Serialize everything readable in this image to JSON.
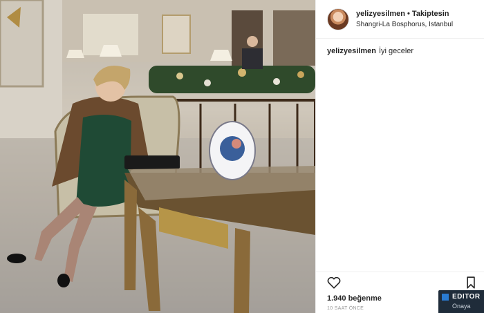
{
  "post": {
    "image_description_alt": "",
    "author": {
      "username": "yelizyesilmen",
      "separator": "•",
      "follow_status": "Takiptesin",
      "location": "Shangri-La Bosphorus, Istanbul"
    },
    "caption": {
      "username": "yelizyesilmen",
      "text": "İyi geceler"
    },
    "actions": {
      "like_icon": "heart-icon",
      "save_icon": "bookmark-icon"
    },
    "likes": "1.940 beğenme",
    "timestamp": "10 SAAT ÖNCE"
  },
  "watermark": {
    "title": "EDITOR",
    "subtitle": "Onaya"
  },
  "colors": {
    "text": "#262626",
    "muted": "#999999",
    "border": "#efefef",
    "dress": "#1f4a35"
  }
}
